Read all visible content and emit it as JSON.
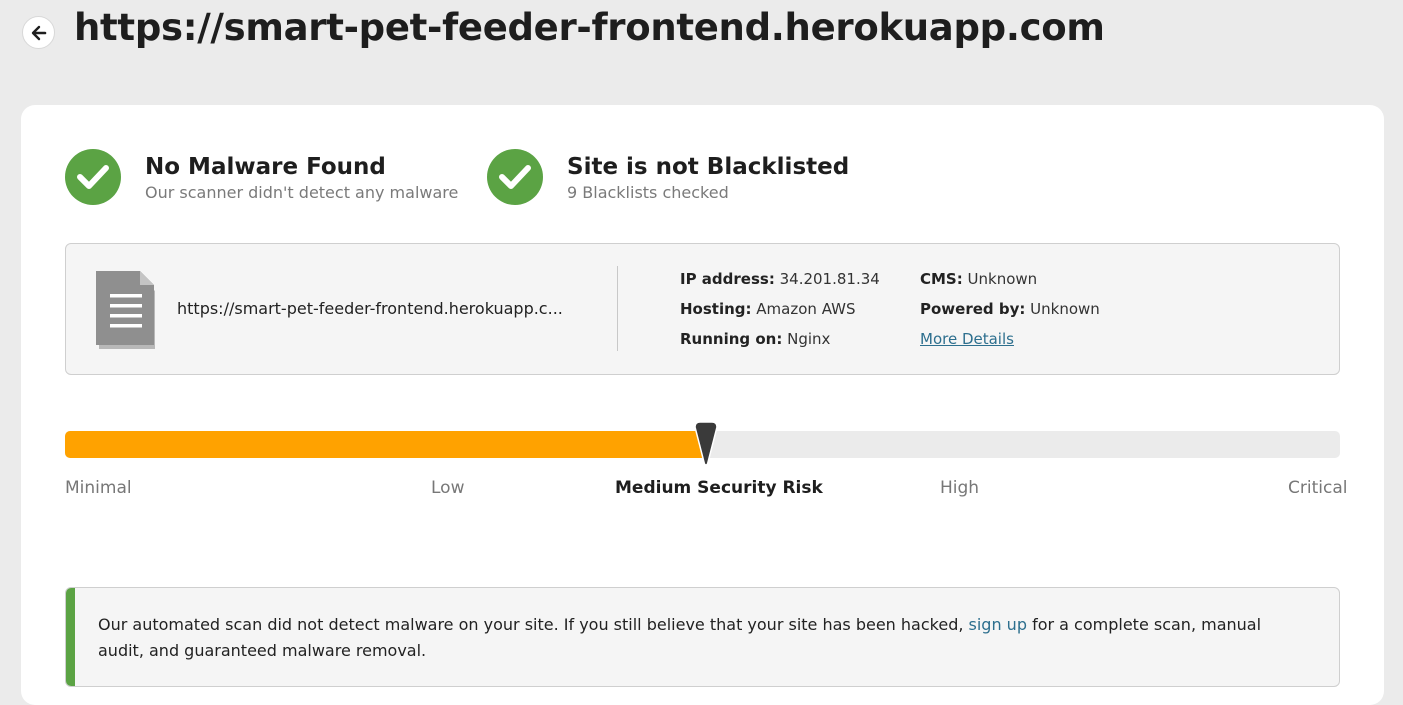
{
  "header": {
    "title": "https://smart-pet-feeder-frontend.herokuapp.com",
    "back_icon": "arrow-left-icon"
  },
  "status_cards": [
    {
      "icon": "check-icon",
      "title": "No Malware Found",
      "subtitle": "Our scanner didn't detect any malware"
    },
    {
      "icon": "check-icon",
      "title": "Site is not Blacklisted",
      "subtitle": "9 Blacklists checked"
    }
  ],
  "site_info": {
    "icon": "document-icon",
    "url": "https://smart-pet-feeder-frontend.herokuapp.c...",
    "ip_label": "IP address:",
    "ip_value": "34.201.81.34",
    "hosting_label": "Hosting:",
    "hosting_value": "Amazon AWS",
    "running_label": "Running on:",
    "running_value": "Nginx",
    "cms_label": "CMS:",
    "cms_value": "Unknown",
    "powered_label": "Powered by:",
    "powered_value": "Unknown",
    "more_details": "More Details"
  },
  "risk": {
    "level_fraction": 0.5,
    "current": "Medium Security Risk",
    "labels": [
      "Minimal",
      "Low",
      "High",
      "Critical"
    ],
    "fill_color": "#ffa200",
    "track_color": "#ebebeb"
  },
  "notice": {
    "text_before": "Our automated scan did not detect malware on your site. If you still believe that your site has been hacked, ",
    "link": "sign up",
    "text_after": " for a complete scan, manual audit, and guaranteed malware removal.",
    "accent_color": "#5ba344"
  },
  "colors": {
    "success": "#5ba344",
    "link": "#2d6f8e",
    "risk_medium": "#ffa200"
  }
}
